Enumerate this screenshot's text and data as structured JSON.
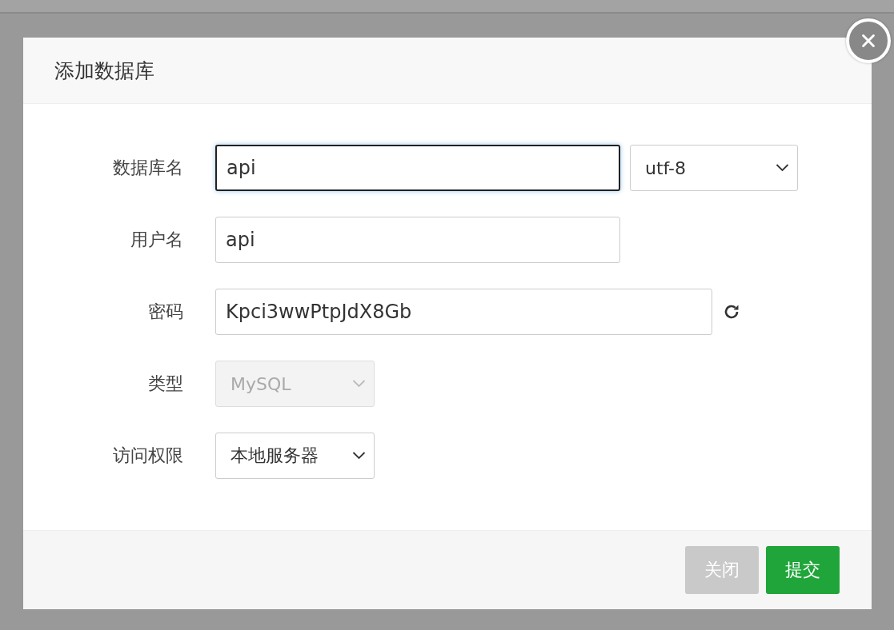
{
  "dialog": {
    "title": "添加数据库",
    "fields": [
      {
        "label": "数据库名",
        "kind": "text-select",
        "value": "api",
        "focused": true,
        "option": "utf-8",
        "disabled": false
      },
      {
        "label": "用户名",
        "kind": "text",
        "value": "api",
        "focused": false
      },
      {
        "label": "密码",
        "kind": "text-refresh",
        "value": "Kpci3wwPtpJdX8Gb",
        "focused": false
      },
      {
        "label": "类型",
        "kind": "select",
        "option": "MySQL",
        "disabled": true
      },
      {
        "label": "访问权限",
        "kind": "select",
        "option": "本地服务器",
        "disabled": false
      }
    ],
    "buttons": [
      {
        "label": "关闭",
        "kind": "secondary"
      },
      {
        "label": "提交",
        "kind": "primary"
      }
    ]
  }
}
